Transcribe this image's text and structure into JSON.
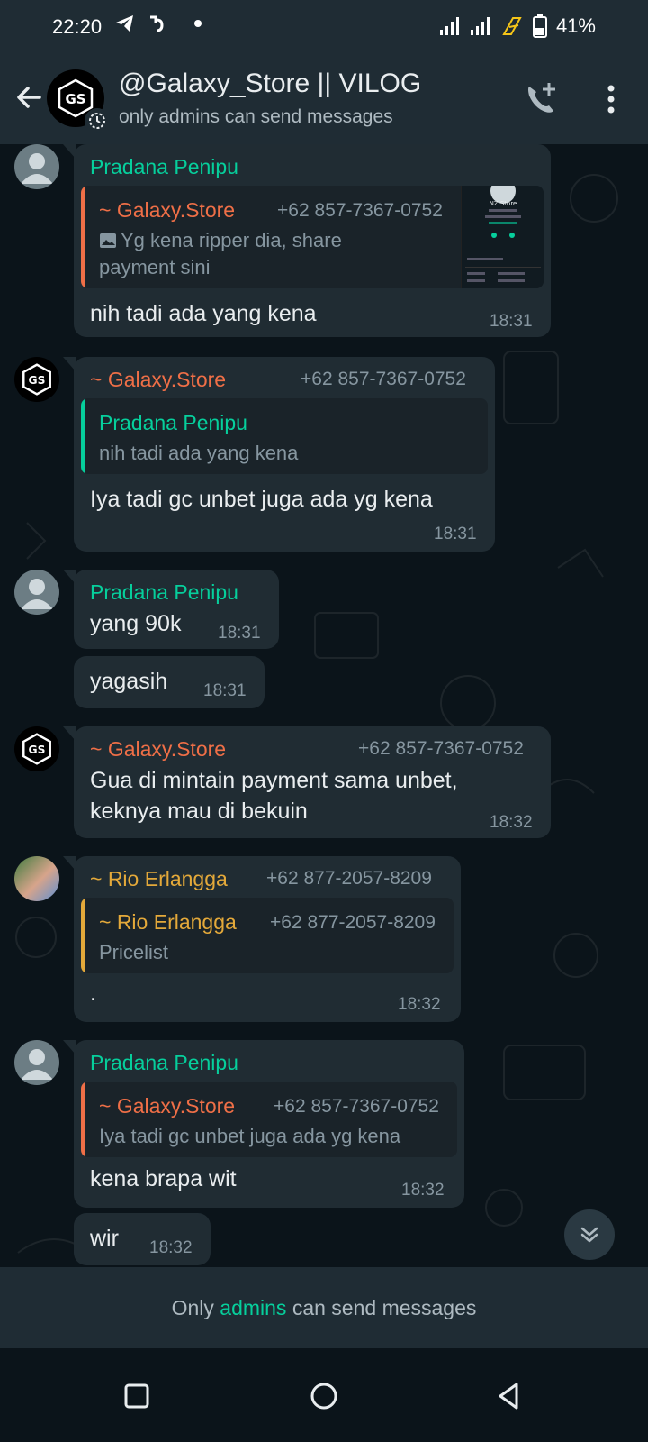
{
  "status_bar": {
    "time": "22:20",
    "battery": "41%",
    "icons": [
      "telegram-icon",
      "app-icon",
      "dot-icon",
      "signal-icon",
      "signal-icon",
      "charging-icon",
      "battery-icon"
    ]
  },
  "header": {
    "title": "@Galaxy_Store || VILOG",
    "subtitle": "only admins can send messages",
    "avatar_text": "GS"
  },
  "messages": [
    {
      "sender": "Pradana Penipu",
      "sender_color": "#06cf9c",
      "quote": {
        "sender": "~ Galaxy.Store",
        "phone": "+62 857-7367-0752",
        "text_line1": "Yg kena ripper dia, share",
        "text_line2": "payment sini",
        "bar_color": "#ef6f47"
      },
      "text": "nih tadi ada yang kena",
      "time": "18:31"
    },
    {
      "sender": "~ Galaxy.Store",
      "phone": "+62 857-7367-0752",
      "quote": {
        "sender": "Pradana Penipu",
        "text": "nih tadi ada yang kena",
        "bar_color": "#06cf9c"
      },
      "text": "Iya tadi gc unbet juga ada yg kena",
      "time": "18:31"
    },
    {
      "sender": "Pradana Penipu",
      "text": "yang 90k",
      "time": "18:31"
    },
    {
      "text": "yagasih",
      "time": "18:31"
    },
    {
      "sender": "~ Galaxy.Store",
      "phone": "+62 857-7367-0752",
      "text_line1": "Gua di mintain payment sama unbet,",
      "text_line2": "keknya mau di bekuin",
      "time": "18:32"
    },
    {
      "sender": "~ Rio Erlangga",
      "phone": "+62 877-2057-8209",
      "quote": {
        "sender": "~ Rio Erlangga",
        "phone": "+62 877-2057-8209",
        "text": "Pricelist",
        "bar_color": "#e4a93a"
      },
      "text": ".",
      "time": "18:32"
    },
    {
      "sender": "Pradana Penipu",
      "quote": {
        "sender": "~ Galaxy.Store",
        "phone": "+62 857-7367-0752",
        "text": "Iya tadi gc unbet juga ada yg kena",
        "bar_color": "#ef6f47"
      },
      "text": "kena brapa wit",
      "time": "18:32"
    },
    {
      "text": "wir",
      "time": "18:32"
    }
  ],
  "thumbnail": {
    "title": "NZ Store"
  },
  "footer": {
    "prefix": "Only ",
    "link": "admins",
    "suffix": " can send messages"
  }
}
